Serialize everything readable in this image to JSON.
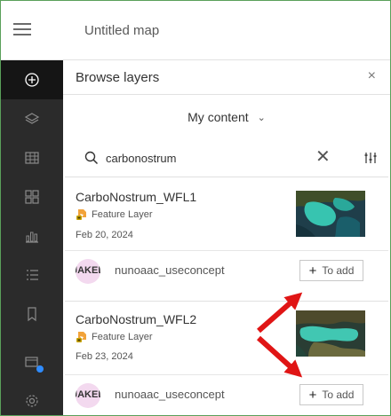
{
  "header": {
    "title": "Untitled map"
  },
  "rail": {
    "items": [
      {
        "icon": "add-icon"
      },
      {
        "icon": "layers-icon"
      },
      {
        "icon": "table-icon"
      },
      {
        "icon": "basemap-icon"
      },
      {
        "icon": "charts-icon"
      },
      {
        "icon": "legend-icon"
      },
      {
        "icon": "bookmark-icon"
      },
      {
        "icon": "map-properties-icon"
      },
      {
        "icon": "settings-icon"
      }
    ]
  },
  "panel": {
    "title": "Browse layers",
    "close": "×",
    "content_selector": "My content",
    "search": {
      "value": "carbonostrum",
      "clear": "✕"
    }
  },
  "results": [
    {
      "name": "CarboNostrum_WFL1",
      "type": "Feature Layer",
      "date": "Feb 20, 2024",
      "avatar_text": "JAKEL",
      "owner": "nunoaac_useconcept",
      "add_label": "To add",
      "plus": "+"
    },
    {
      "name": "CarboNostrum_WFL2",
      "type": "Feature Layer",
      "date": "Feb 23, 2024",
      "avatar_text": "JAKEL",
      "owner": "nunoaac_useconcept",
      "add_label": "To add",
      "plus": "+"
    }
  ],
  "colors": {
    "rail": "#2b2b2b",
    "accent": "#2f8cff",
    "annotation": "#e01515",
    "frame": "#5aa05a"
  }
}
